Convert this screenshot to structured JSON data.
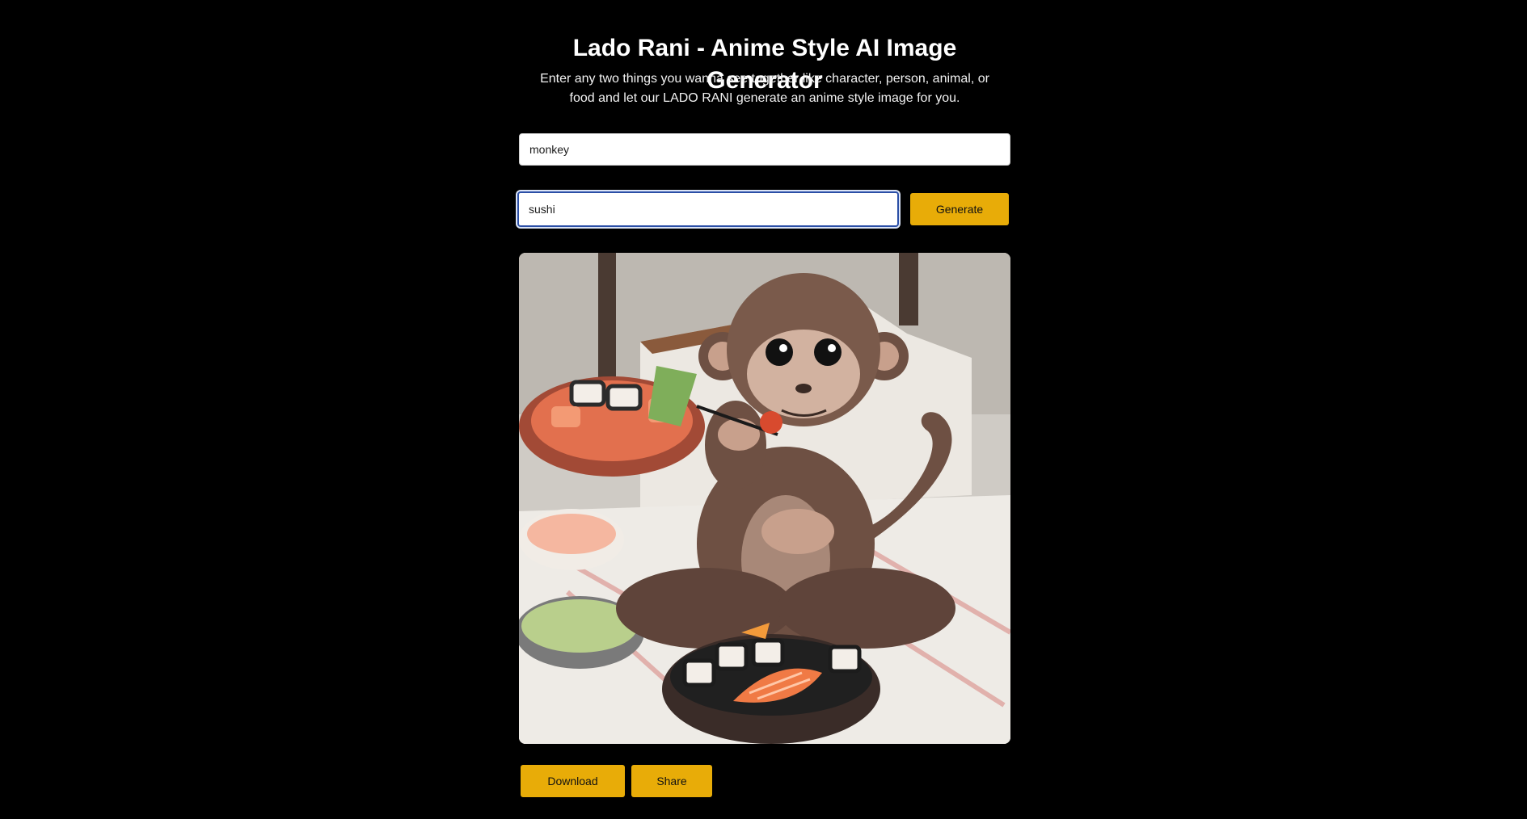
{
  "header": {
    "title": "Lado Rani - Anime Style AI Image Generator",
    "subtitle": "Enter any two things you wanna see together like character, person, animal, or food and let our LADO RANI generate an anime style image for you."
  },
  "form": {
    "first_value": "monkey",
    "second_value": "sushi",
    "generate_label": "Generate"
  },
  "result": {
    "image_subject": "anime monkey eating sushi"
  },
  "actions": {
    "download_label": "Download",
    "share_label": "Share"
  },
  "colors": {
    "background": "#000000",
    "accent": "#e8ac08",
    "focus_border": "#2b4fa6"
  }
}
